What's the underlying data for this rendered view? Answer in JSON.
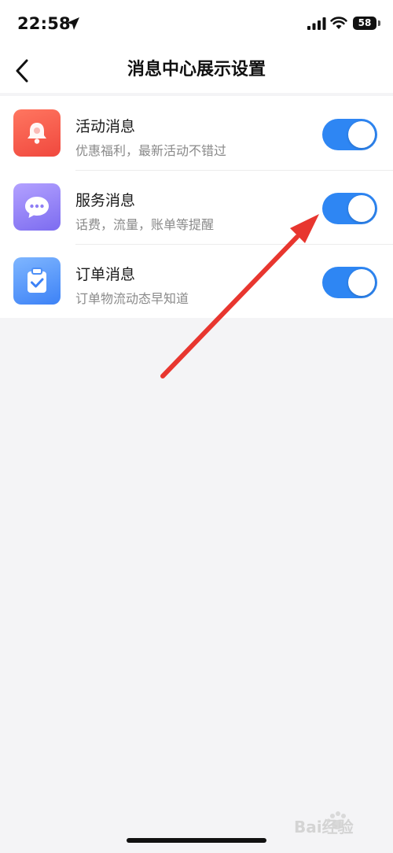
{
  "status_bar": {
    "time": "22:58",
    "battery": "58"
  },
  "header": {
    "title": "消息中心展示设置",
    "back_icon": "chevron-left-icon"
  },
  "settings": [
    {
      "id": "activity",
      "title": "活动消息",
      "subtitle": "优惠福利，最新活动不错过",
      "icon": "bell-icon",
      "icon_colors": [
        "#ff7660",
        "#f0483e"
      ],
      "enabled": true
    },
    {
      "id": "service",
      "title": "服务消息",
      "subtitle": "话费，流量，账单等提醒",
      "icon": "chat-bubble-icon",
      "icon_colors": [
        "#b3a1ff",
        "#7c6cf0"
      ],
      "enabled": true
    },
    {
      "id": "order",
      "title": "订单消息",
      "subtitle": "订单物流动态早知道",
      "icon": "clipboard-check-icon",
      "icon_colors": [
        "#7fb6ff",
        "#3d82f6"
      ],
      "enabled": true
    }
  ],
  "colors": {
    "toggle_on": "#2e86f3",
    "background": "#f4f4f6",
    "annotation_arrow": "#e8362f"
  },
  "watermark": {
    "text": "Bai经验"
  }
}
